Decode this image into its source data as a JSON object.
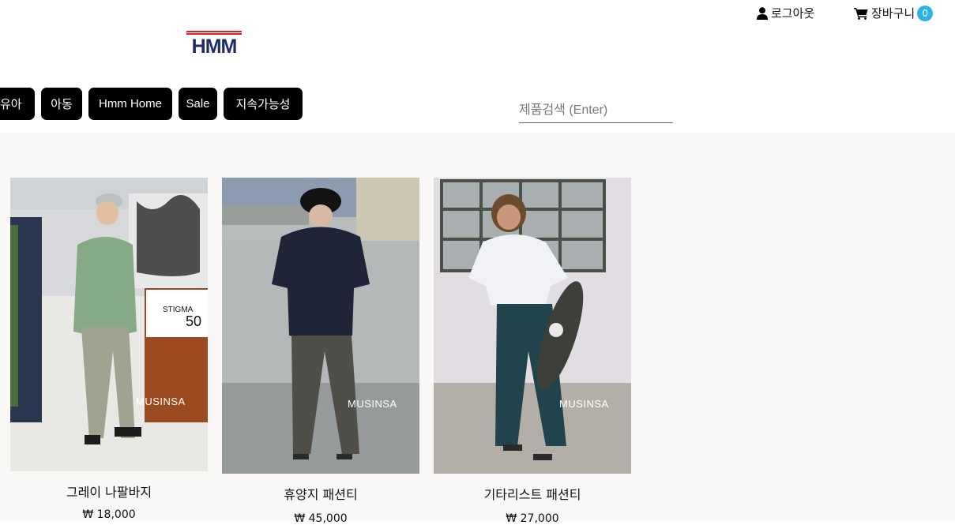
{
  "header": {
    "logo_text": "HMM",
    "logout_label": "로그아웃",
    "cart_label": "장바구니",
    "cart_count": "0"
  },
  "nav": {
    "items": [
      {
        "label": "유아"
      },
      {
        "label": "아동"
      },
      {
        "label": "Hmm Home"
      },
      {
        "label": "Sale"
      },
      {
        "label": "지속가능성"
      }
    ]
  },
  "search": {
    "placeholder": "제품검색 (Enter)"
  },
  "products": [
    {
      "name": "그레이 나팔바지",
      "price": "₩ 18,000",
      "photo_watermark": "MUSINSA",
      "sign_brand": "STIGMA",
      "sign_percent": "50"
    },
    {
      "name": "휴양지 패션티",
      "price": "₩ 45,000",
      "photo_watermark": "MUSINSA"
    },
    {
      "name": "기타리스트 패션티",
      "price": "₩ 27,000",
      "photo_watermark": "MUSINSA"
    }
  ],
  "colors": {
    "nav_bg": "#000000",
    "badge": "#2bb3e6",
    "logo_red": "#d9242c",
    "logo_navy": "#1f2a6b",
    "content_bg": "#f9f8f7"
  },
  "icons": {
    "logout": "user-icon",
    "cart": "cart-icon"
  }
}
